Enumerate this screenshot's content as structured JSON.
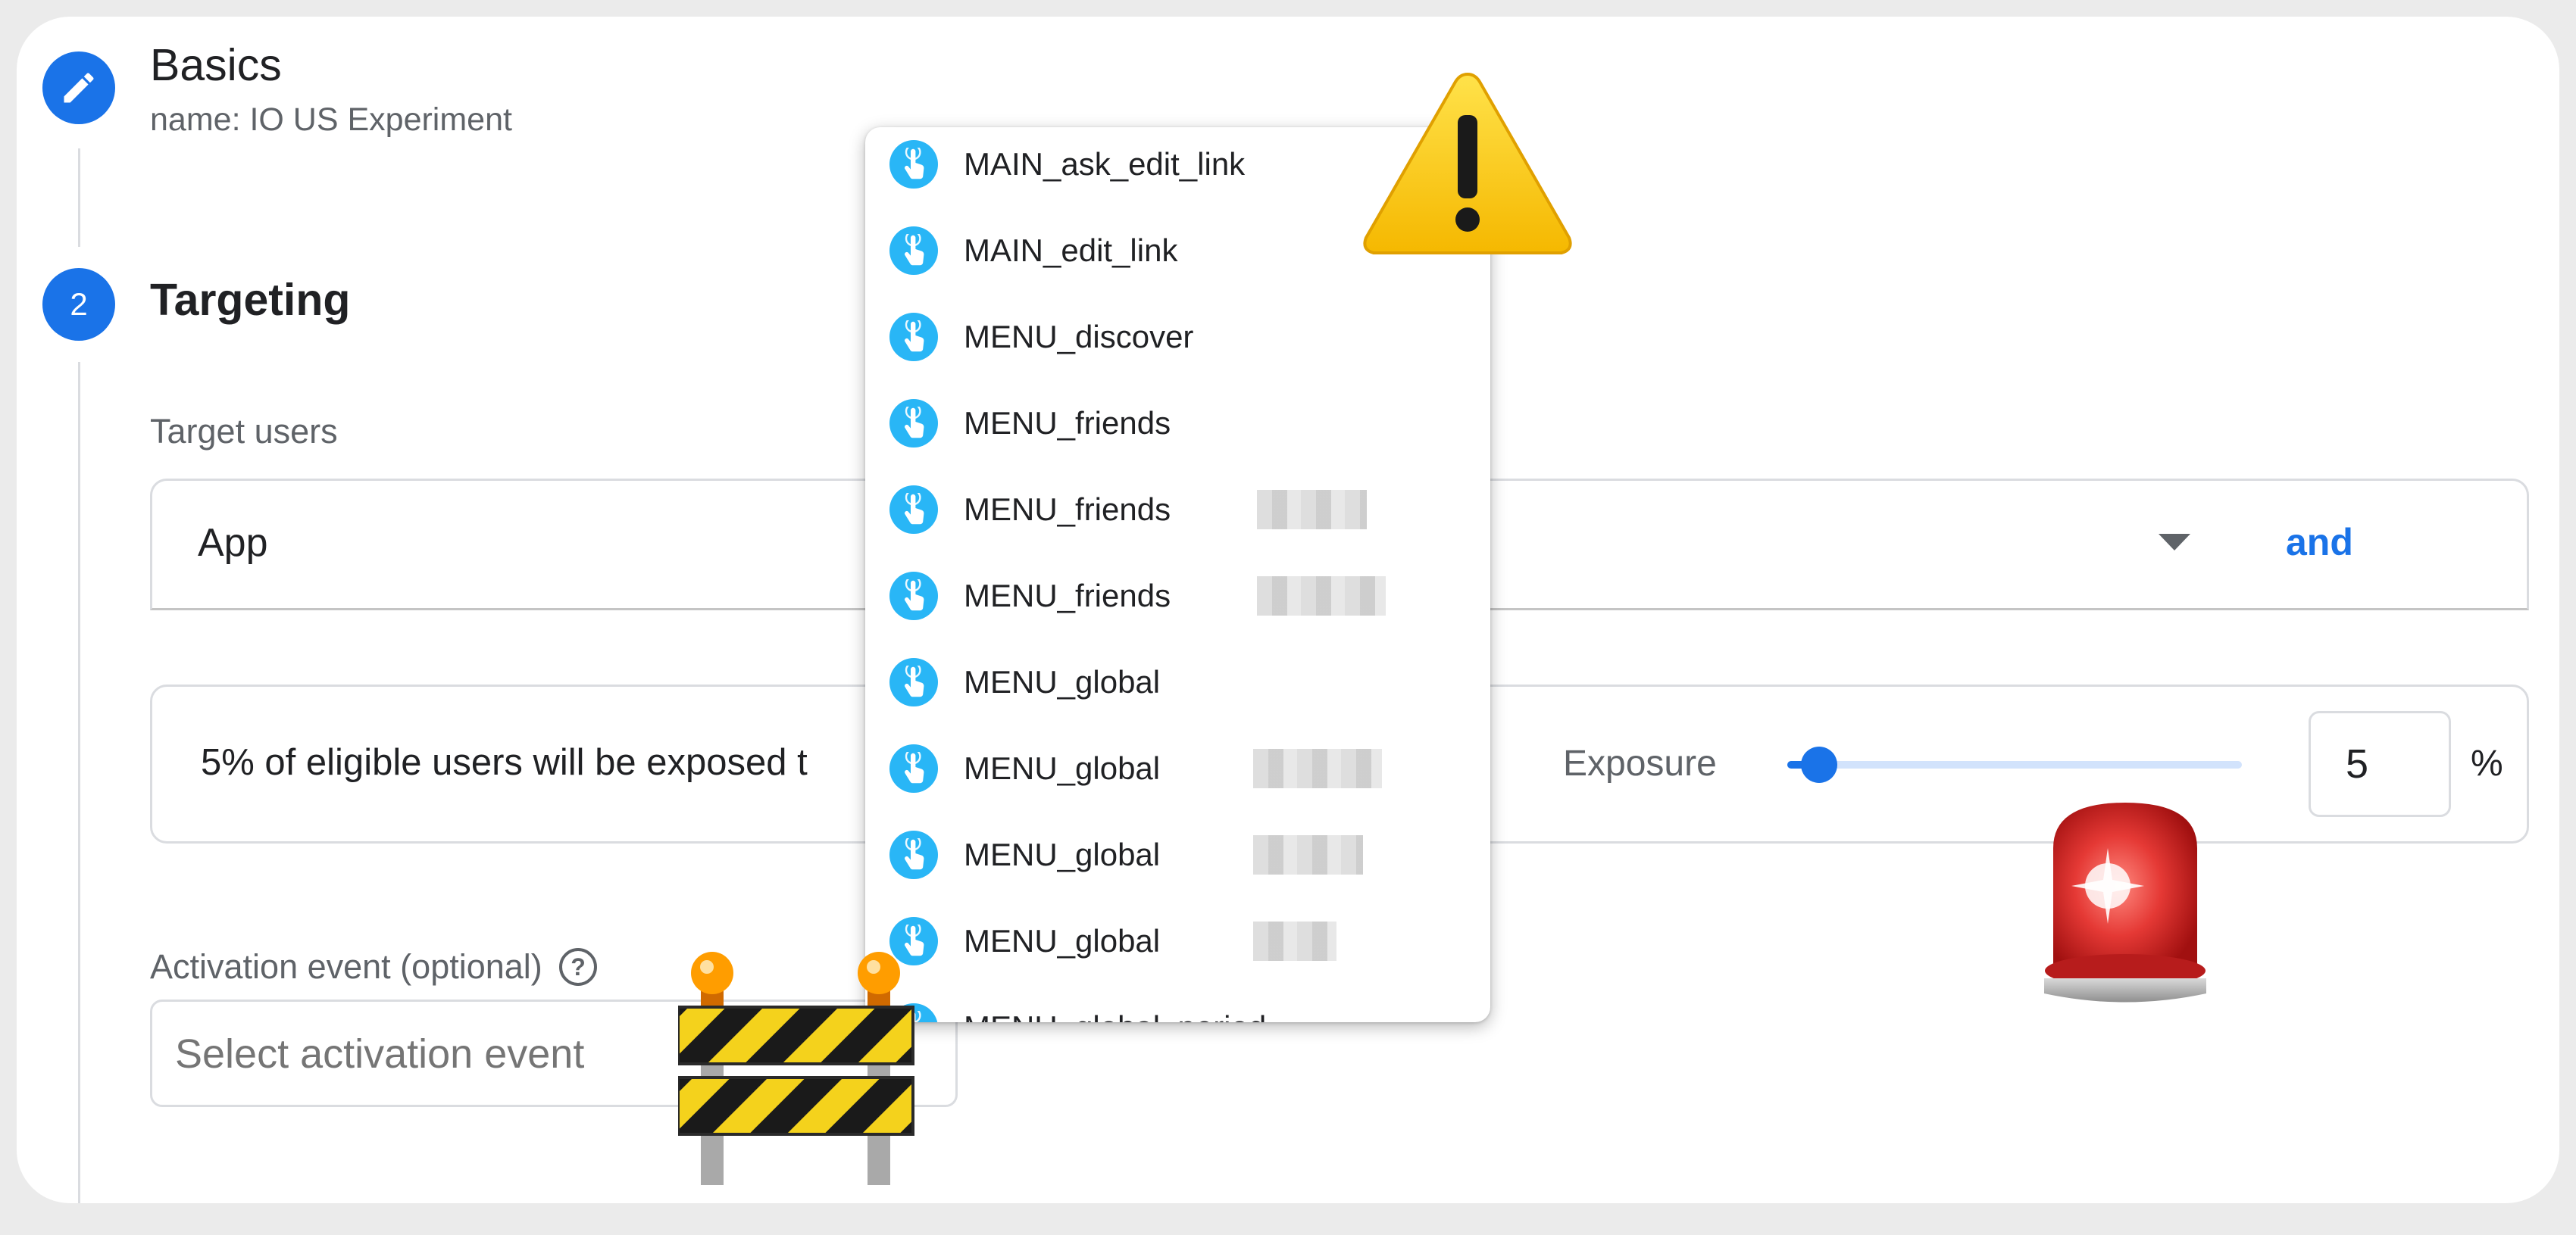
{
  "basics": {
    "title": "Basics",
    "subtitle": "name: IO US Experiment"
  },
  "targeting": {
    "step_number": "2",
    "title": "Targeting",
    "target_users_label": "Target users",
    "app_value": "App",
    "and_label": "and",
    "exposure_text": "5% of eligible users will be exposed t",
    "exposure_label": "Exposure",
    "exposure_value": "5",
    "exposure_unit": "%",
    "exposure_fraction": 0.05,
    "activation_label": "Activation event (optional)",
    "activation_placeholder": "Select activation event"
  },
  "dropdown": {
    "items": [
      {
        "label": "MAIN_ask_edit_link",
        "redacted": false
      },
      {
        "label": "MAIN_edit_link",
        "redacted": false
      },
      {
        "label": "MENU_discover",
        "redacted": false
      },
      {
        "label": "MENU_friends",
        "redacted": false
      },
      {
        "label": "MENU_friends",
        "redacted": true
      },
      {
        "label": "MENU_friends",
        "redacted": true
      },
      {
        "label": "MENU_global",
        "redacted": false
      },
      {
        "label": "MENU_global",
        "redacted": true
      },
      {
        "label": "MENU_global",
        "redacted": true
      },
      {
        "label": "MENU_global",
        "redacted": true
      },
      {
        "label": "MENU_global_period",
        "redacted": false
      }
    ]
  },
  "colors": {
    "accent": "#1a73e8",
    "event_icon": "#29b6f6",
    "border": "#dadce0"
  },
  "icons": {
    "basics_step": "pencil-icon",
    "event_item": "touch-hand-icon",
    "help": "help-circle-icon",
    "dropdown_arrow": "caret-down-icon",
    "sticker_warning": "warning-sign-icon",
    "sticker_siren": "siren-light-icon",
    "sticker_barrier": "construction-barrier-icon"
  }
}
